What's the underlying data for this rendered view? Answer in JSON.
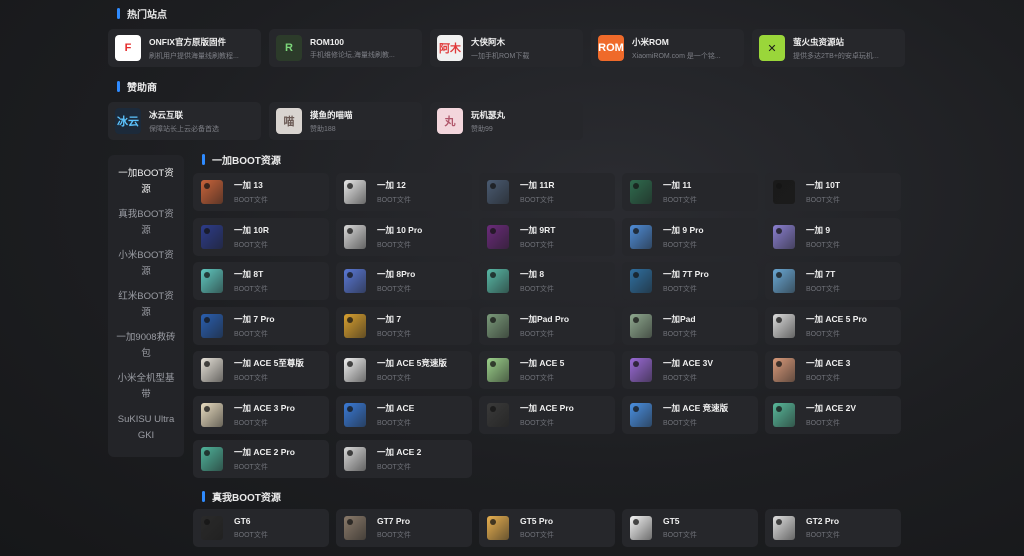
{
  "sections": {
    "hot_sites": "热门站点",
    "sponsors": "赞助商",
    "oneplus": "一加BOOT资源",
    "realme": "真我BOOT资源"
  },
  "hot_sites": [
    {
      "name": "ONFIX官方原版固件",
      "desc": "刷机用户提供海量线刷教程...",
      "logo_text": "F",
      "logo_bg": "#ffffff",
      "logo_fg": "#e52b2b"
    },
    {
      "name": "ROM100",
      "desc": "手机维修论坛,海量线刷教...",
      "logo_text": "R",
      "logo_bg": "#2c3b2a",
      "logo_fg": "#7cd67a"
    },
    {
      "name": "大侠阿木",
      "desc": "一加手机ROM下载",
      "logo_text": "阿木",
      "logo_bg": "#f1f1f1",
      "logo_fg": "#e03a3a"
    },
    {
      "name": "小米ROM",
      "desc": "XiaomiROM.com 是一个铭...",
      "logo_text": "ROM",
      "logo_bg": "#ef6a2a",
      "logo_fg": "#ffffff"
    },
    {
      "name": "萤火虫资源站",
      "desc": "提供多达2TB+的安卓玩机...",
      "logo_text": "✕",
      "logo_bg": "#9ad63a",
      "logo_fg": "#1b1b1b"
    }
  ],
  "sponsors": [
    {
      "name": "冰云互联",
      "desc": "保障站长上云必备首选",
      "logo_text": "冰云",
      "logo_bg": "#1c2a3a",
      "logo_fg": "#5cc4ff"
    },
    {
      "name": "摸鱼的喵喵",
      "desc": "赞助188",
      "logo_text": "喵",
      "logo_bg": "#d9d4d0",
      "logo_fg": "#6b5a55"
    },
    {
      "name": "玩机瑟丸",
      "desc": "赞助99",
      "logo_text": "丸",
      "logo_bg": "#f3d6dc",
      "logo_fg": "#b0566a"
    }
  ],
  "side_nav": [
    {
      "label": "一加BOOT资源",
      "active": true
    },
    {
      "label": "真我BOOT资源",
      "active": false
    },
    {
      "label": "小米BOOT资源",
      "active": false
    },
    {
      "label": "红米BOOT资源",
      "active": false
    },
    {
      "label": "一加9008救砖包",
      "active": false
    },
    {
      "label": "小米全机型基带",
      "active": false
    },
    {
      "label": "SuKISU Ultra GKI",
      "active": false
    }
  ],
  "card_sub": "BOOT文件",
  "oneplus_devices": [
    {
      "name": "一加 13",
      "color": "#c9633a"
    },
    {
      "name": "一加 12",
      "color": "#e8e8e8"
    },
    {
      "name": "一加 11R",
      "color": "#4a5b72"
    },
    {
      "name": "一加 11",
      "color": "#2f6b4e"
    },
    {
      "name": "一加 10T",
      "color": "#1a1a1a"
    },
    {
      "name": "一加 10R",
      "color": "#2d3c8a"
    },
    {
      "name": "一加 10 Pro",
      "color": "#d9d9d9"
    },
    {
      "name": "一加 9RT",
      "color": "#6a2b7a"
    },
    {
      "name": "一加 9 Pro",
      "color": "#4f8cd6"
    },
    {
      "name": "一加 9",
      "color": "#8a7fd0"
    },
    {
      "name": "一加 8T",
      "color": "#5fc7bf"
    },
    {
      "name": "一加 8Pro",
      "color": "#5a78d6"
    },
    {
      "name": "一加 8",
      "color": "#58b8a6"
    },
    {
      "name": "一加 7T Pro",
      "color": "#2f6fa0"
    },
    {
      "name": "一加 7T",
      "color": "#6aa8d4"
    },
    {
      "name": "一加 7 Pro",
      "color": "#2a5fb0"
    },
    {
      "name": "一加 7",
      "color": "#d8a030"
    },
    {
      "name": "一加Pad Pro",
      "color": "#7a9a7a"
    },
    {
      "name": "一加Pad",
      "color": "#8fa98f"
    },
    {
      "name": "一加 ACE 5 Pro",
      "color": "#dcdcdc"
    },
    {
      "name": "一加 ACE 5至尊版",
      "color": "#e6e1d8"
    },
    {
      "name": "一加 ACE 5竞速版",
      "color": "#f0f0f0"
    },
    {
      "name": "一加 ACE 5",
      "color": "#9bd08a"
    },
    {
      "name": "一加 ACE 3V",
      "color": "#9a6ad6"
    },
    {
      "name": "一加 ACE 3",
      "color": "#d99a7a"
    },
    {
      "name": "一加 ACE 3 Pro",
      "color": "#e8dcc0"
    },
    {
      "name": "一加 ACE",
      "color": "#3a7ad6"
    },
    {
      "name": "一加 ACE Pro",
      "color": "#3a3a3a"
    },
    {
      "name": "一加 ACE 竞速版",
      "color": "#4a90e2"
    },
    {
      "name": "一加 ACE 2V",
      "color": "#58b89a"
    },
    {
      "name": "一加 ACE 2 Pro",
      "color": "#4fb29a"
    },
    {
      "name": "一加 ACE 2",
      "color": "#d8d8d8"
    }
  ],
  "realme_devices": [
    {
      "name": "GT6",
      "color": "#2a2a2a"
    },
    {
      "name": "GT7 Pro",
      "color": "#8a7a6a"
    },
    {
      "name": "GT5 Pro",
      "color": "#e8b050"
    },
    {
      "name": "GT5",
      "color": "#f4f4f4"
    },
    {
      "name": "GT2 Pro",
      "color": "#e0e0e0"
    }
  ]
}
